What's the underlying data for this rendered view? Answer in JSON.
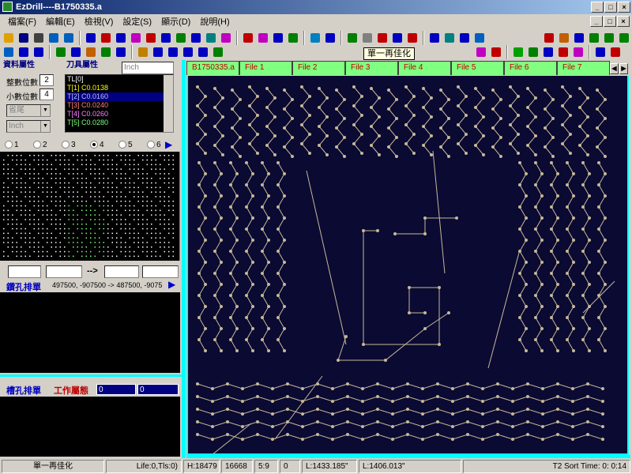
{
  "window": {
    "title": "EzDrill----B1750335.a",
    "min": "_",
    "max": "□",
    "close": "×"
  },
  "menu": [
    {
      "label": "檔案(F)"
    },
    {
      "label": "編輯(E)"
    },
    {
      "label": "檢視(V)"
    },
    {
      "label": "設定(S)"
    },
    {
      "label": "顯示(D)"
    },
    {
      "label": "說明(H)"
    }
  ],
  "tooltip": "單一再佳化",
  "toolbar1": [
    {
      "icon": "open-folder-icon",
      "color": "#e0a000"
    },
    {
      "icon": "save-icon",
      "color": "#000080"
    },
    {
      "icon": "print-icon",
      "color": "#404040"
    },
    {
      "icon": "import-icon",
      "color": "#0060c0"
    },
    {
      "icon": "export-icon",
      "color": "#0060c0"
    },
    {
      "sep": true
    },
    {
      "icon": "target-icon",
      "color": "#0000c0"
    },
    {
      "icon": "pattern-icon",
      "color": "#c00000"
    },
    {
      "icon": "grid-icon",
      "color": "#0000c0"
    },
    {
      "icon": "bars-icon",
      "color": "#c000c0"
    },
    {
      "icon": "circle-icon",
      "color": "#c00000"
    },
    {
      "icon": "cube-icon",
      "color": "#0000c0"
    },
    {
      "icon": "cross-icon",
      "color": "#008000"
    },
    {
      "icon": "cross-icon",
      "color": "#0000c0"
    },
    {
      "icon": "arrow-icon",
      "color": "#008080"
    },
    {
      "icon": "mirror-icon",
      "color": "#c000c0"
    },
    {
      "sep": true
    },
    {
      "icon": "exclaim-icon",
      "color": "#c00000"
    },
    {
      "icon": "exclaim-icon",
      "color": "#c000c0"
    },
    {
      "icon": "exclaim-icon",
      "color": "#0000c0"
    },
    {
      "icon": "exclaim-icon",
      "color": "#008000"
    },
    {
      "sep": true
    },
    {
      "icon": "star-icon",
      "color": "#0080c0"
    },
    {
      "icon": "wand-icon",
      "color": "#0000c0"
    },
    {
      "sep": true
    },
    {
      "icon": "scissors-icon",
      "color": "#008000"
    },
    {
      "icon": "link-icon",
      "color": "#808080"
    },
    {
      "icon": "optimize-icon",
      "color": "#c00000"
    },
    {
      "icon": "path-icon",
      "color": "#0000c0"
    },
    {
      "icon": "zoom-region-icon",
      "color": "#c00000"
    },
    {
      "sep": true
    },
    {
      "icon": "undo-icon",
      "color": "#0000c0"
    },
    {
      "icon": "flip-icon",
      "color": "#008080"
    },
    {
      "icon": "move-icon",
      "color": "#0000c0"
    },
    {
      "icon": "layer-icon",
      "color": "#0060c0"
    }
  ],
  "toolbar1_right": [
    {
      "icon": "delete-icon",
      "color": "#c00000"
    },
    {
      "icon": "grid-icon",
      "color": "#c06000"
    },
    {
      "icon": "table-icon",
      "color": "#0000c0"
    },
    {
      "icon": "table-icon",
      "color": "#008000"
    },
    {
      "icon": "funnel-icon",
      "color": "#008000"
    },
    {
      "icon": "nc-icon",
      "color": "#008000"
    }
  ],
  "toolbar2": [
    {
      "icon": "circle-icon",
      "color": "#0060c0"
    },
    {
      "icon": "square-icon",
      "color": "#0000c0"
    },
    {
      "icon": "half-circle-icon",
      "color": "#0000c0"
    },
    {
      "sep": true
    },
    {
      "icon": "grid-icon",
      "color": "#008000"
    },
    {
      "icon": "grid-icon",
      "color": "#0000c0"
    },
    {
      "icon": "grid-icon",
      "color": "#c06000"
    },
    {
      "icon": "grid-icon",
      "color": "#008000"
    },
    {
      "icon": "box-icon",
      "color": "#0000c0"
    },
    {
      "sep": true
    },
    {
      "icon": "hand-icon",
      "color": "#c08000"
    },
    {
      "icon": "zoom-fit-icon",
      "color": "#0000c0"
    },
    {
      "icon": "zoom-in-icon",
      "color": "#0000c0"
    },
    {
      "icon": "zoom-out-icon",
      "color": "#0000c0"
    },
    {
      "icon": "zoom-window-icon",
      "color": "#0000c0"
    },
    {
      "icon": "anchor-icon",
      "color": "#008000"
    }
  ],
  "toolbar2_right": [
    {
      "icon": "dash-grid-icon",
      "color": "#c000c0"
    },
    {
      "icon": "dash-grid-icon",
      "color": "#c00000"
    },
    {
      "sep": true
    },
    {
      "icon": "green-bar-icon",
      "color": "#00a000"
    },
    {
      "icon": "connect-icon",
      "color": "#008000"
    },
    {
      "icon": "split-icon",
      "color": "#0000c0"
    },
    {
      "icon": "flow-icon",
      "color": "#c00000"
    },
    {
      "icon": "dash-grid-icon",
      "color": "#c000c0"
    },
    {
      "sep": true
    },
    {
      "icon": "pen-icon",
      "color": "#0000c0"
    },
    {
      "icon": "cut-icon",
      "color": "#c00000"
    }
  ],
  "left": {
    "tab1": "資料屬性",
    "tab2": "刀具屬性",
    "unit": "Inch",
    "int_digits_label": "整數位數",
    "int_digits": "2",
    "dec_digits_label": "小數位數",
    "dec_digits": "4",
    "zero_mode": "省尾",
    "unit2": "Inch",
    "tools": [
      {
        "text": "TL[0]",
        "color": "#ffffff"
      },
      {
        "text": "T[1] C0.0138",
        "color": "#ffff00"
      },
      {
        "text": "T[2] C0.0160",
        "color": "#c0c0ff",
        "selected": true
      },
      {
        "text": "T[3] C0.0240",
        "color": "#ff8080"
      },
      {
        "text": "T[4] C0.0260",
        "color": "#ff80ff"
      },
      {
        "text": "T[5] C0.0280",
        "color": "#80ff80"
      }
    ],
    "radios": [
      {
        "label": "1",
        "on": false
      },
      {
        "label": "2",
        "on": false
      },
      {
        "label": "3",
        "on": false
      },
      {
        "label": "4",
        "on": true
      },
      {
        "label": "5",
        "on": false
      },
      {
        "label": "6",
        "on": false
      }
    ],
    "range_arrow": "-->",
    "drill_label": "鑽孔排單",
    "drill_coords": "497500, -907500 -> 487500, -9075",
    "slot_label": "槽孔排單",
    "work_label": "工作屬態",
    "field1": "0",
    "field2": "0"
  },
  "filetabs": [
    {
      "label": "B1750335.a",
      "active": true
    },
    {
      "label": "File 1"
    },
    {
      "label": "File 2"
    },
    {
      "label": "File 3"
    },
    {
      "label": "File 4"
    },
    {
      "label": "File 5"
    },
    {
      "label": "File 6"
    },
    {
      "label": "File 7"
    }
  ],
  "statusbar": {
    "msg": "單一再佳化",
    "life": "Life:0,Tls:0)",
    "h": "H:18479",
    "n": "16668",
    "ratio": "5:9",
    "z": "0",
    "l1": "L:1433.185\"",
    "l2": "L:1406.013\"",
    "sort": "T2 Sort Time:  0: 0:14"
  }
}
